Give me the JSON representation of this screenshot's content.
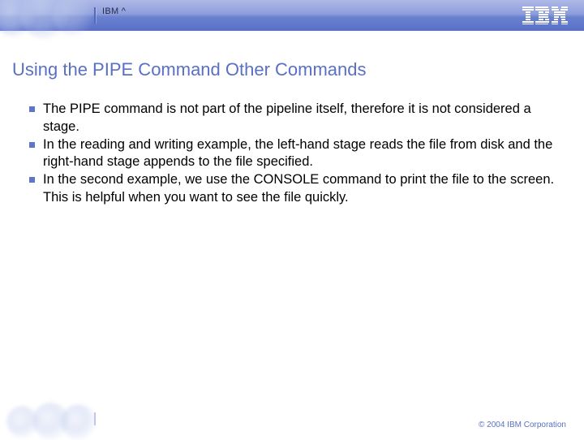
{
  "header": {
    "brand_label": "IBM ^"
  },
  "slide": {
    "title": "Using the PIPE Command Other Commands",
    "bullets": [
      "The PIPE command is not part of the pipeline itself, therefore it is not considered a stage.",
      "In the reading and writing example, the left-hand stage reads the file from disk and the right-hand stage appends to the file specified.",
      "In the second example, we use the CONSOLE command to print the file to the screen.  This is helpful when you want to see the file quickly."
    ]
  },
  "footer": {
    "copyright": "© 2004 IBM Corporation"
  }
}
